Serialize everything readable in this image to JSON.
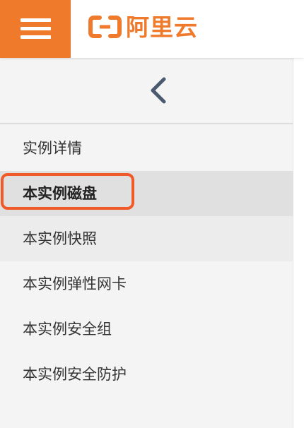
{
  "header": {
    "menu_icon": "hamburger-menu-icon",
    "logo_icon": "aliyun-logo-mark",
    "logo_text": "阿里云",
    "brand_color": "#ef7a2c"
  },
  "sidebar": {
    "collapse_icon": "chevron-left-icon",
    "items": [
      {
        "label": "实例详情",
        "state": "normal"
      },
      {
        "label": "本实例磁盘",
        "state": "selected"
      },
      {
        "label": "本实例快照",
        "state": "hover"
      },
      {
        "label": "本实例弹性网卡",
        "state": "normal"
      },
      {
        "label": "本实例安全组",
        "state": "normal"
      },
      {
        "label": "本实例安全防护",
        "state": "normal"
      }
    ],
    "highlight_color": "#f05a28"
  }
}
